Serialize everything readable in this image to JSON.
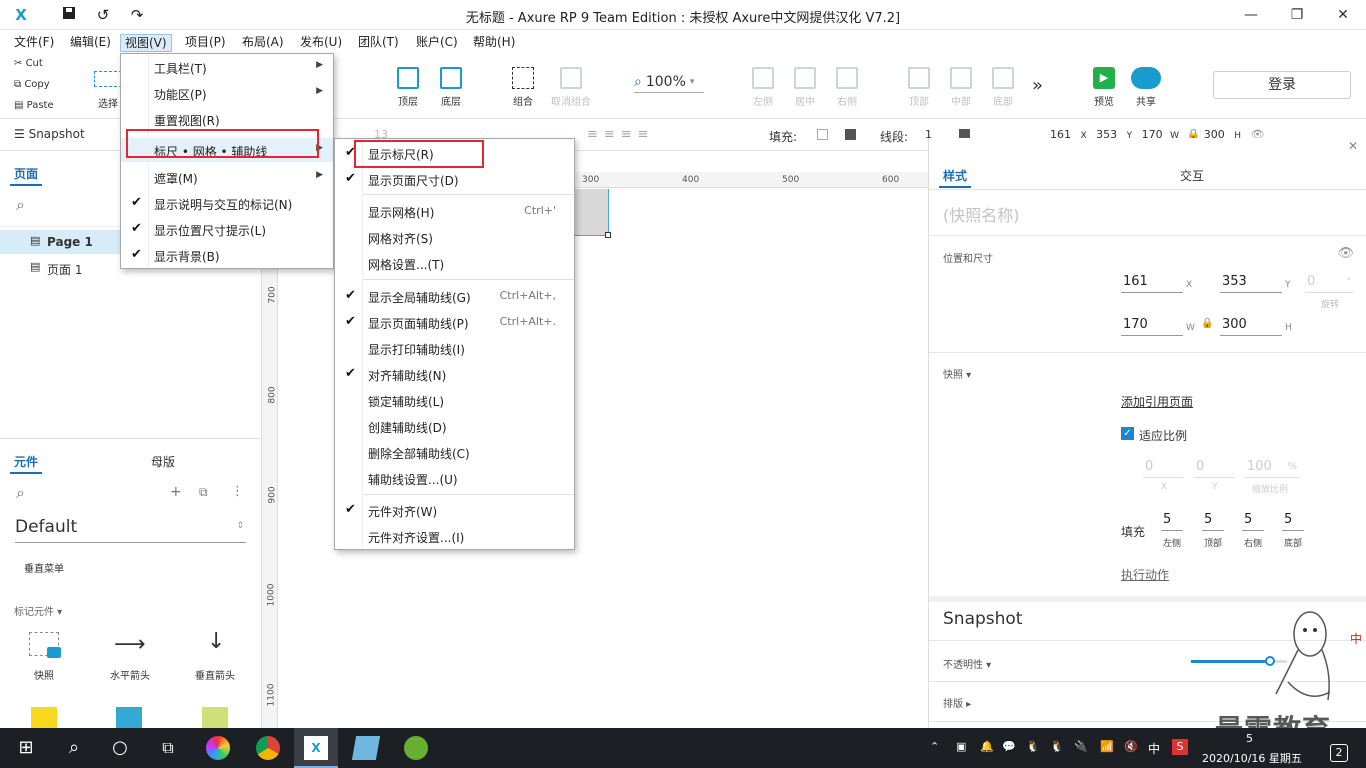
{
  "window": {
    "title": "无标题 - Axure RP 9 Team Edition : 未授权    Axure中文网提供汉化 V7.2]",
    "app_logo": "X"
  },
  "menubar": {
    "items": [
      "文件(F)",
      "编辑(E)",
      "视图(V)",
      "项目(P)",
      "布局(A)",
      "发布(U)",
      "团队(T)",
      "账户(C)",
      "帮助(H)"
    ]
  },
  "clipboard": {
    "cut": "Cut",
    "copy": "Copy",
    "paste": "Paste"
  },
  "toolbar": {
    "select": "选择",
    "top": "顶层",
    "bottom": "底层",
    "group": "组合",
    "ungroup": "取消组合",
    "zoom": "100%",
    "left": "左侧",
    "center": "居中",
    "right": "右侧",
    "top_align": "顶部",
    "middle": "中部",
    "bottom_align": "底部",
    "preview": "预览",
    "share": "共享",
    "login": "登录"
  },
  "formatbar": {
    "snapshot": "Snapshot",
    "font_size": "13",
    "fill_label": "填充:",
    "line_label": "线段:",
    "line_value": "1",
    "x": "161",
    "x_label": "X",
    "y": "353",
    "y_label": "Y",
    "w": "170",
    "w_label": "W",
    "h": "300",
    "h_label": "H"
  },
  "pages_panel": {
    "tab": "页面",
    "pages": [
      "Page 1",
      "页面 1"
    ]
  },
  "lib_panel": {
    "tab_widgets": "元件",
    "tab_masters": "母版",
    "library": "Default",
    "section_menu": "垂直菜单",
    "section_markers": "标记元件 ▾",
    "widgets": [
      "快照",
      "水平箭头",
      "垂直箭头"
    ],
    "swatch_colors": [
      "#f9d71c",
      "#33a9d6",
      "#cfe07a"
    ]
  },
  "ruler": {
    "top": [
      "300",
      "400",
      "500",
      "600"
    ],
    "left": [
      "700",
      "800",
      "900",
      "1000",
      "1100"
    ]
  },
  "view_menu": {
    "items": [
      {
        "label": "工具栏(T)",
        "check": "",
        "arrow": "▶"
      },
      {
        "label": "功能区(P)",
        "check": "",
        "arrow": "▶"
      },
      {
        "label": "重置视图(R)",
        "check": "",
        "arrow": ""
      },
      {
        "label": "标尺 • 网格 • 辅助线",
        "check": "",
        "arrow": "▶"
      },
      {
        "label": "遮罩(M)",
        "check": "",
        "arrow": "▶"
      },
      {
        "label": "显示说明与交互的标记(N)",
        "check": "✔",
        "arrow": ""
      },
      {
        "label": "显示位置尺寸提示(L)",
        "check": "✔",
        "arrow": ""
      },
      {
        "label": "显示背景(B)",
        "check": "✔",
        "arrow": ""
      }
    ]
  },
  "sub_menu": {
    "items": [
      {
        "label": "显示标尺(R)",
        "check": "✔",
        "shortcut": ""
      },
      {
        "label": "显示页面尺寸(D)",
        "check": "✔",
        "shortcut": ""
      },
      {
        "label": "显示网格(H)",
        "check": "",
        "shortcut": "Ctrl+'"
      },
      {
        "label": "网格对齐(S)",
        "check": "",
        "shortcut": ""
      },
      {
        "label": "网格设置...(T)",
        "check": "",
        "shortcut": ""
      },
      {
        "label": "显示全局辅助线(G)",
        "check": "✔",
        "shortcut": "Ctrl+Alt+,"
      },
      {
        "label": "显示页面辅助线(P)",
        "check": "✔",
        "shortcut": "Ctrl+Alt+."
      },
      {
        "label": "显示打印辅助线(I)",
        "check": "",
        "shortcut": ""
      },
      {
        "label": "对齐辅助线(N)",
        "check": "✔",
        "shortcut": ""
      },
      {
        "label": "锁定辅助线(L)",
        "check": "",
        "shortcut": ""
      },
      {
        "label": "创建辅助线(D)",
        "check": "",
        "shortcut": ""
      },
      {
        "label": "删除全部辅助线(C)",
        "check": "",
        "shortcut": ""
      },
      {
        "label": "辅助线设置...(U)",
        "check": "",
        "shortcut": ""
      },
      {
        "label": "元件对齐(W)",
        "check": "✔",
        "shortcut": ""
      },
      {
        "label": "元件对齐设置...(I)",
        "check": "",
        "shortcut": ""
      }
    ]
  },
  "right_panel": {
    "tab_style": "样式",
    "tab_interact": "交互",
    "name_placeholder": "(快照名称)",
    "pos_size_label": "位置和尺寸",
    "x": "161",
    "y": "353",
    "rotation": "0",
    "rotation_unit": "°",
    "rotation_label": "旋转",
    "w": "170",
    "h": "300",
    "unit_x": "X",
    "unit_y": "Y",
    "unit_w": "W",
    "unit_h": "H",
    "snapshot_label": "快照 ▾",
    "add_ref": "添加引用页面",
    "fit_ratio": "适应比例",
    "off_x": "0",
    "off_y": "0",
    "scale": "100",
    "scale_unit": "%",
    "scale_label": "缩放比例",
    "fill_label": "填充",
    "pad_left": "5",
    "pad_top": "5",
    "pad_right": "5",
    "pad_bottom": "5",
    "pad_left_label": "左侧",
    "pad_top_label": "顶部",
    "pad_right_label": "右侧",
    "pad_bottom_label": "底部",
    "action": "执行动作",
    "section_title": "Snapshot",
    "opacity_label": "不透明性 ▾",
    "opacity_value": 0.82,
    "layout_label": "排版 ▸"
  },
  "watermark": {
    "text": "最需教育"
  },
  "taskbar": {
    "time": "5",
    "date": "2020/10/16 星期五",
    "ime": "中",
    "notif": "2"
  }
}
